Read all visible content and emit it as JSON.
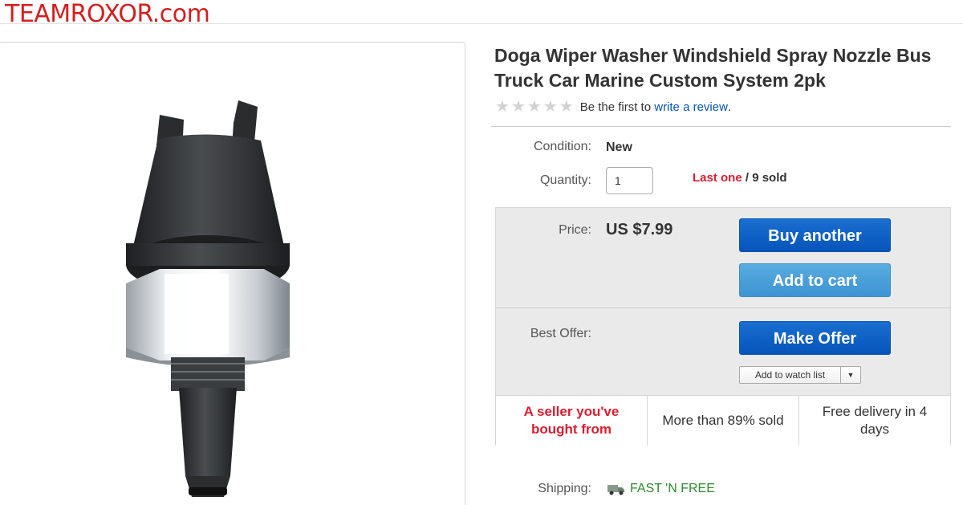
{
  "watermark": "TEAMROXOR.com",
  "product": {
    "title": "Doga Wiper Washer Windshield Spray Nozzle Bus Truck Car Marine Custom System 2pk",
    "rating_stars": 0,
    "review_prefix": "Be the first to ",
    "review_link": "write a review",
    "review_suffix": "."
  },
  "condition": {
    "label": "Condition:",
    "value": "New"
  },
  "quantity": {
    "label": "Quantity:",
    "value": "1",
    "stock_highlight": "Last one",
    "stock_rest": " / 9 sold"
  },
  "price": {
    "label": "Price:",
    "value": "US $7.99"
  },
  "buttons": {
    "buy": "Buy another",
    "cart": "Add to cart",
    "offer": "Make Offer",
    "watch": "Add to watch list"
  },
  "best_offer": {
    "label": "Best Offer:"
  },
  "badges": [
    "A seller you've bought from",
    "More than 89% sold",
    "Free delivery in 4 days"
  ],
  "shipping": {
    "label": "Shipping:",
    "value": "FAST 'N FREE"
  },
  "colors": {
    "brand_red": "#d41f1f",
    "link_blue": "#0654ba",
    "alert_red": "#dd1e31",
    "ship_green": "#2b8a2b"
  }
}
